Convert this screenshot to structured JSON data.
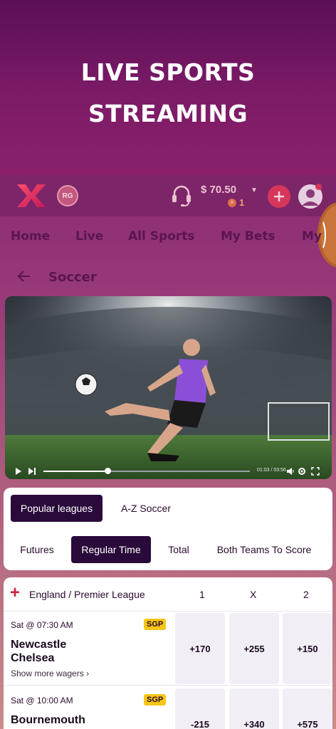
{
  "hero": {
    "title_line1": "LIVE SPORTS",
    "title_line2": "STREAMING"
  },
  "topbar": {
    "logo_icon": "x-logo-icon",
    "rg_badge": "RG",
    "support_icon": "headset-icon",
    "balance": "$ 70.50",
    "coins": "1",
    "add_icon": "plus-icon",
    "avatar_icon": "user-avatar-icon"
  },
  "nav": {
    "items": [
      "Home",
      "Live",
      "All Sports",
      "My Bets",
      "My"
    ]
  },
  "breadcrumb": {
    "title": "Soccer"
  },
  "video": {
    "time": "01:03 / 03:56",
    "progress": 0.31
  },
  "filters": {
    "league_tabs": [
      "Popular leagues",
      "A-Z Soccer"
    ],
    "market_tabs": [
      "Futures",
      "Regular Time",
      "Total",
      "Both Teams To Score"
    ]
  },
  "league": {
    "name": "England / Premier League",
    "col1": "1",
    "colx": "X",
    "col2": "2"
  },
  "matches": [
    {
      "time": "Sat @ 07:30 AM",
      "badge": "SGP",
      "home": "Newcastle",
      "away": "Chelsea",
      "more": "Show more wagers",
      "odds": [
        "+170",
        "+255",
        "+150"
      ]
    },
    {
      "time": "Sat @ 10:00 AM",
      "badge": "SGP",
      "home": "Bournemouth",
      "away": "",
      "more": "",
      "odds": [
        "-215",
        "+340",
        "+575"
      ]
    }
  ],
  "colors": {
    "accent": "#d5365a",
    "dark": "#2a0a3a",
    "brand": "#7d2569",
    "sgp": "#f5c518"
  }
}
